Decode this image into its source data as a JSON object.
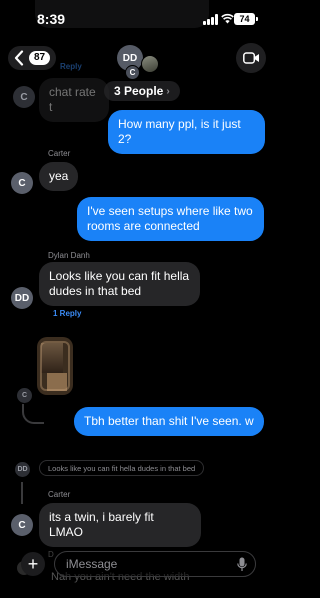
{
  "status_bar": {
    "time": "8:39",
    "battery": "74"
  },
  "nav": {
    "back_count": "87",
    "group_name": "3 People",
    "avatar_initials_main": "DD",
    "avatar_initials_small": "C"
  },
  "messages": [
    {
      "id": "m0",
      "direction": "incoming",
      "text": "chat rate t",
      "avatar": "C",
      "faded": true
    },
    {
      "id": "m0_reply",
      "text": "Reply"
    },
    {
      "id": "m1",
      "direction": "outgoing",
      "text": "How many ppl, is it just 2?"
    },
    {
      "id": "m2",
      "direction": "incoming",
      "sender": "Carter",
      "avatar": "C",
      "text": "yea"
    },
    {
      "id": "m3",
      "direction": "outgoing",
      "text": "I've seen setups where like two rooms are connected"
    },
    {
      "id": "m4",
      "direction": "incoming",
      "sender": "Dylan Danh",
      "avatar": "DD",
      "text": "Looks like you can fit hella dudes in that bed",
      "reply_count": "1 Reply"
    },
    {
      "id": "m5",
      "direction": "incoming",
      "type": "photo",
      "avatar": "C"
    },
    {
      "id": "m6",
      "direction": "outgoing",
      "text": "Tbh better than shit I've seen. w"
    },
    {
      "id": "m7",
      "type": "reply_quote",
      "avatar": "DD",
      "text": "Looks like you can fit hella dudes in that bed"
    },
    {
      "id": "m8",
      "direction": "incoming",
      "sender": "Carter",
      "avatar": "C",
      "text": "its a twin, i barely fit LMAO"
    },
    {
      "id": "m9",
      "direction": "incoming",
      "sender": "D",
      "text": "Nah you ain't need the width",
      "faded": true
    }
  ],
  "compose": {
    "placeholder": "iMessage",
    "plus": "+"
  },
  "colors": {
    "outgoing": "#1a82f7",
    "incoming": "#262628",
    "link": "#3b8cf7",
    "background": "#000000"
  },
  "icons": [
    "chevron-left-icon",
    "video-camera-icon",
    "microphone-icon",
    "plus-icon",
    "signal-icon",
    "wifi-icon",
    "battery-icon"
  ]
}
